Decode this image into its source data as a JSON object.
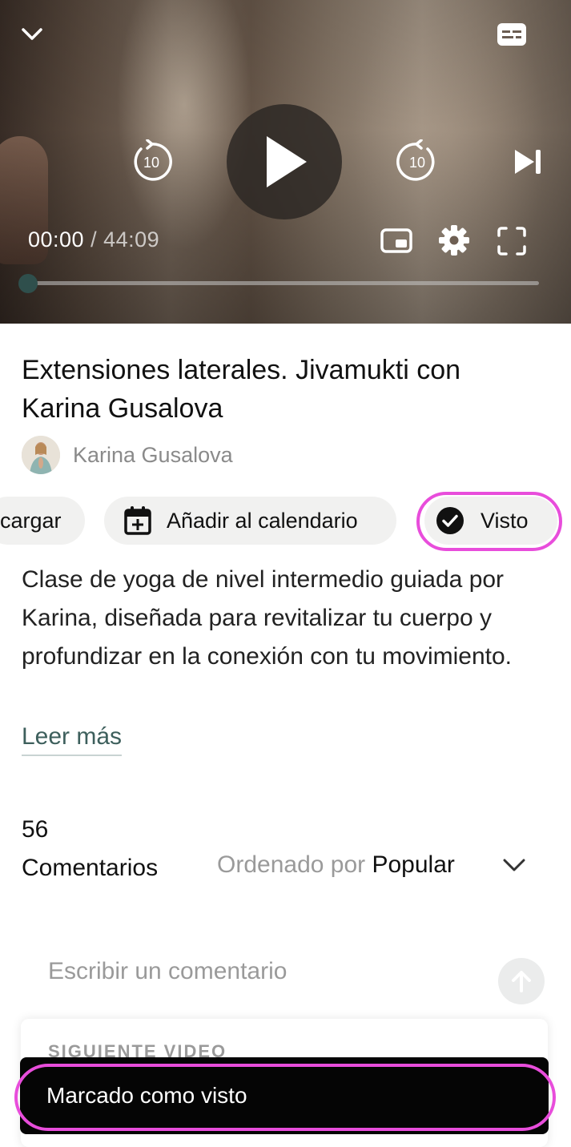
{
  "player": {
    "current_time": "00:00",
    "separator": " / ",
    "duration": "44:09",
    "rewind_seconds": "10",
    "forward_seconds": "10",
    "progress": 0.0,
    "icons": [
      "chevron-down-icon",
      "captions-icon",
      "rewind-10-icon",
      "play-icon",
      "forward-10-icon",
      "skip-next-icon",
      "picture-in-picture-icon",
      "gear-icon",
      "fullscreen-icon"
    ]
  },
  "video": {
    "title": "Extensiones laterales. Jivamukti con Karina Gusalova",
    "author": "Karina Gusalova"
  },
  "actions": {
    "download_label": "cargar",
    "calendar_label": "Añadir al calendario",
    "seen_label": "Visto"
  },
  "description": {
    "text": "Clase de yoga de nivel intermedio guiada por Karina, diseñada para revitalizar tu cuerpo y profundizar en la conexión con tu movimiento.",
    "read_more": "Leer más"
  },
  "comments": {
    "count": "56",
    "label": "Comentarios",
    "sort_prefix": "Ordenado por",
    "sort_value": "Popular",
    "input_placeholder": "Escribir un comentario"
  },
  "next_video": {
    "label": "SIGUIENTE VIDEO"
  },
  "toast": {
    "message": "Marcado como visto"
  },
  "colors": {
    "accent": "#2f4f4c",
    "highlight": "#e84ddb",
    "chip_bg": "#f1f1f0",
    "toast_bg": "#050505"
  }
}
